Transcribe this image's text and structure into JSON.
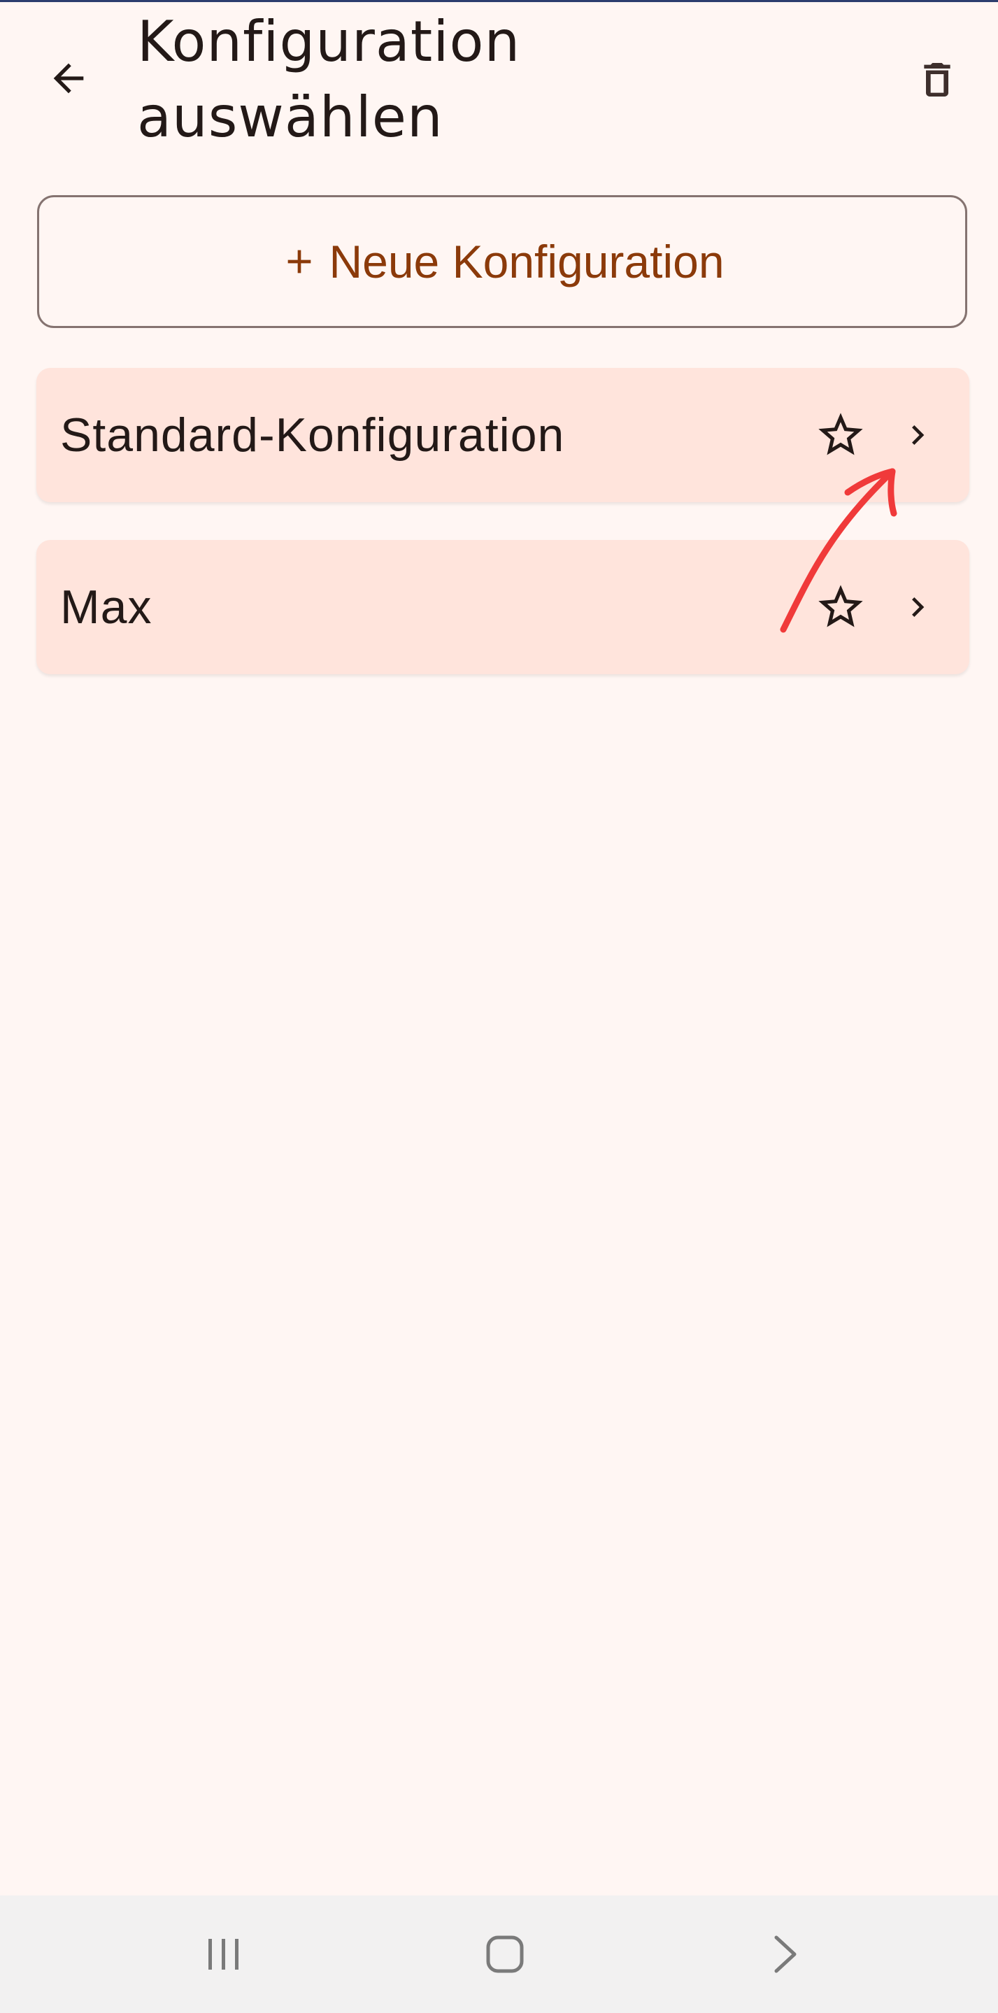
{
  "header": {
    "title_line1": "Konfiguration",
    "title_line2": "auswählen",
    "back_icon": "arrow-left-icon",
    "delete_icon": "trash-icon"
  },
  "new_button": {
    "plus_icon": "plus-icon",
    "label": "Neue Konfiguration"
  },
  "configurations": [
    {
      "name": "Standard-Konfiguration",
      "favorite": false
    },
    {
      "name": "Max",
      "favorite": false
    }
  ],
  "system_nav": {
    "recents_icon": "recents-icon",
    "home_icon": "home-icon",
    "back_icon": "chevron-right-icon"
  },
  "colors": {
    "background": "#FFF6F3",
    "card_background": "#FFE4DC",
    "accent": "#8B3A0A",
    "text": "#231917",
    "outline": "#857370",
    "annotation": "#F03A3A",
    "navbar": "#F2F1F1"
  }
}
